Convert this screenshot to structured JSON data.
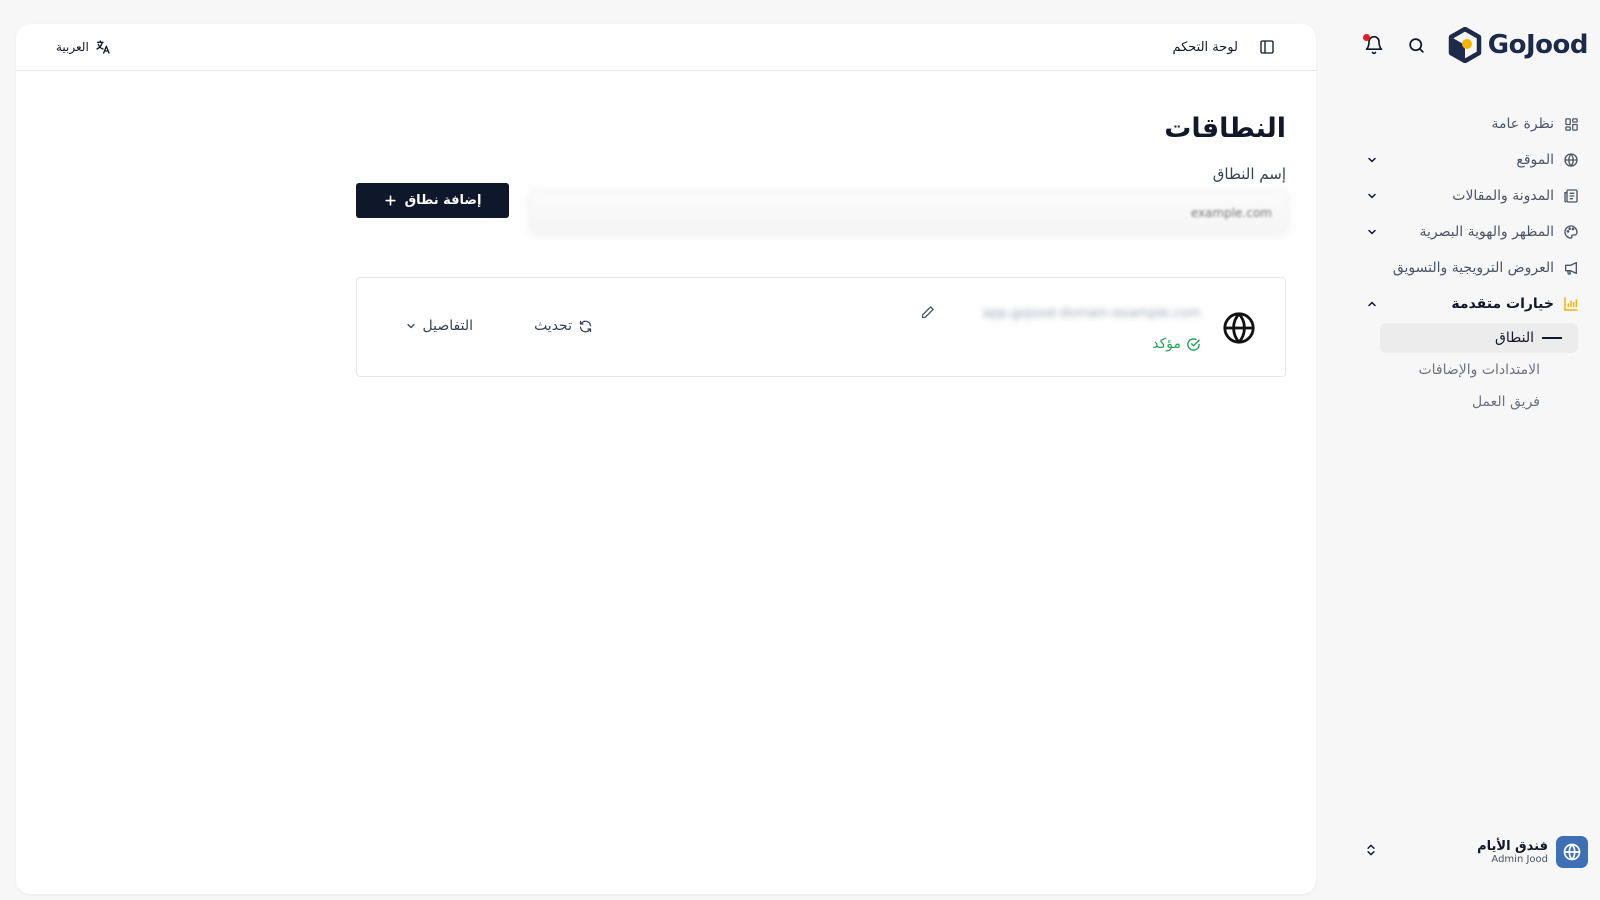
{
  "app": {
    "logo_text": "GoJood",
    "accent_color": "#f5b400",
    "logo_dark": "#1e2a4a"
  },
  "sidebar": {
    "items": [
      {
        "label": "نظرة عامة",
        "icon": "dashboard-grid-icon",
        "has_chevron": false
      },
      {
        "label": "الموقع",
        "icon": "globe-icon",
        "has_chevron": true
      },
      {
        "label": "المدونة والمقالات",
        "icon": "newspaper-icon",
        "has_chevron": true
      },
      {
        "label": "المظهر والهوية البصرية",
        "icon": "palette-icon",
        "has_chevron": true
      },
      {
        "label": "العروض الترويجية والتسويق",
        "icon": "megaphone-icon",
        "has_chevron": false
      },
      {
        "label": "خيارات متقدمة",
        "icon": "bar-chart-icon",
        "has_chevron": true,
        "expanded": true
      }
    ],
    "sub_items": [
      {
        "label": "النطاق",
        "active": true
      },
      {
        "label": "الامتدادات والإضافات",
        "active": false
      },
      {
        "label": "فريق العمل",
        "active": false
      }
    ],
    "footer": {
      "org_name": "فندق الأيام",
      "user_name": "Admin Jood"
    }
  },
  "topbar": {
    "breadcrumb": "لوحة التحكم",
    "language": "العربية"
  },
  "page": {
    "title": "النطاقات",
    "field_label": "إسم النطاق",
    "input_placeholder": "example.com",
    "add_button_label": "إضافة نطاق"
  },
  "domain_card": {
    "domain": "app.gojood-domain-example.com",
    "status": "مؤكد",
    "status_color": "#22a35a",
    "refresh_label": "تحديث",
    "details_label": "التفاصيل"
  }
}
